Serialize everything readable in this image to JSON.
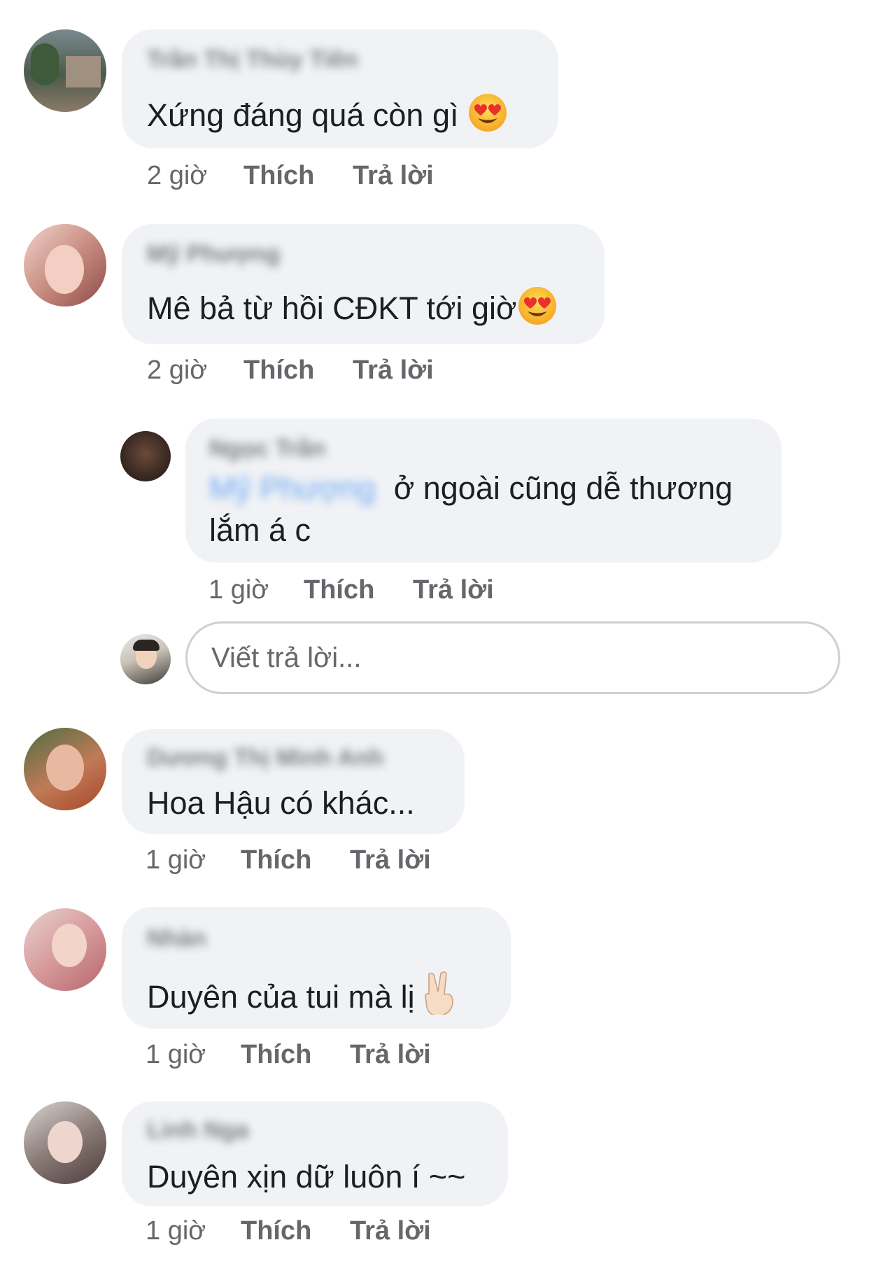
{
  "comments": [
    {
      "author": "Trần Thị Thùy Tiên",
      "text": "Xứng đáng quá còn gì",
      "emoji": "heart-eyes-emoji",
      "time": "2 giờ",
      "like_label": "Thích",
      "reply_label": "Trả lời"
    },
    {
      "author": "Mỹ Phượng",
      "text": "Mê bả từ hồi CĐKT tới giờ",
      "emoji": "heart-eyes-emoji",
      "time": "2 giờ",
      "like_label": "Thích",
      "reply_label": "Trả lời"
    },
    {
      "author": "Ngọc Trần",
      "mention": "Mỹ Phượng",
      "text_line1": "ở ngoài cũng dễ thương",
      "text_line2": "lắm á c",
      "time": "1 giờ",
      "like_label": "Thích",
      "reply_label": "Trả lời"
    },
    {
      "author": "Dương Thị Minh Anh",
      "text": "Hoa Hậu có khác...",
      "time": "1 giờ",
      "like_label": "Thích",
      "reply_label": "Trả lời"
    },
    {
      "author": "Nhàn",
      "text": "Duyên của tui mà lị",
      "emoji": "victory-hand-emoji",
      "time": "1 giờ",
      "like_label": "Thích",
      "reply_label": "Trả lời"
    },
    {
      "author": "Linh Nga",
      "text": "Duyên xịn dữ luôn í ~~",
      "time": "1 giờ",
      "like_label": "Thích",
      "reply_label": "Trả lời"
    }
  ],
  "reply_box": {
    "placeholder": "Viết trả lời..."
  },
  "colors": {
    "bubble": "#f0f2f5",
    "meta_text": "#65676b",
    "mention": "#1877f2"
  }
}
